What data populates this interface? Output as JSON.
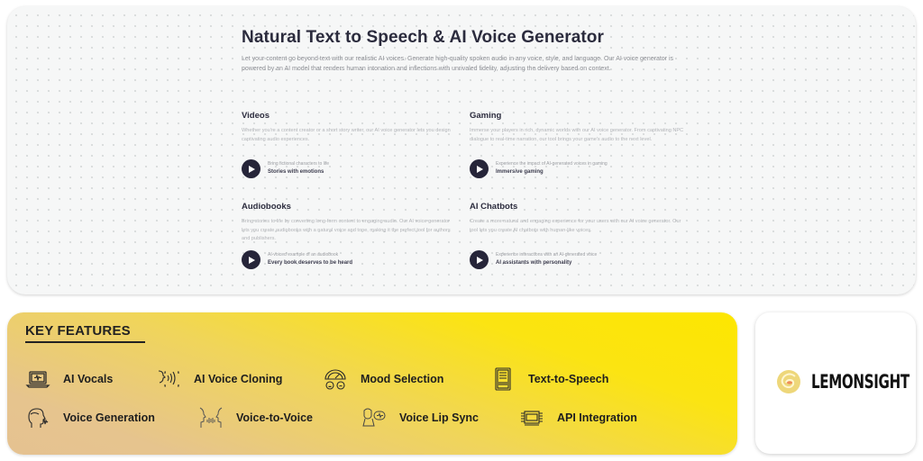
{
  "hero": {
    "title": "Natural Text to Speech & AI Voice Generator",
    "description": "Let your content go beyond text with our realistic AI voices. Generate high-quality spoken audio in any voice, style, and language. Our AI voice generator is powered by an AI model that renders human intonation and inflections with unrivaled fidelity, adjusting the delivery based on context."
  },
  "use_cases": [
    {
      "title": "Videos",
      "description": "Whether you're a content creator or a short story writer, our AI voice generator lets you design captivating audio experiences.",
      "sample_caption": "Bring fictional characters to life",
      "sample_title": "Stories with emotions"
    },
    {
      "title": "Gaming",
      "description": "Immerse your players in rich, dynamic worlds with our AI voice generator. From captivating NPC dialogue to real-time narration, our tool brings your game's audio to the next level.",
      "sample_caption": "Experience the impact of AI-generated voices in gaming",
      "sample_title": "Immersive gaming"
    },
    {
      "title": "Audiobooks",
      "description": "Bring stories to life by converting long-form content to engaging audio. Our AI voice generator lets you create audiobooks with a natural voice and tone, making it the perfect tool for authors and publishers.",
      "sample_caption": "AI-voiced example of an audiobook",
      "sample_title": "Every book deserves to be heard"
    },
    {
      "title": "AI Chatbots",
      "description": "Create a more natural and engaging experience for your users with our AI voice generator. Our tool lets you create AI chatbots with human-like voices.",
      "sample_caption": "Experience interactions with an AI-generated voice",
      "sample_title": "AI assistants with personality"
    }
  ],
  "features": {
    "title": "KEY FEATURES",
    "items": [
      {
        "label": "AI Vocals",
        "icon": "laptop-waveform-icon"
      },
      {
        "label": "AI Voice Cloning",
        "icon": "voice-cloning-icon"
      },
      {
        "label": "Mood Selection",
        "icon": "mood-gauge-icon"
      },
      {
        "label": "Text-to-Speech",
        "icon": "text-document-icon"
      },
      {
        "label": "Voice Generation",
        "icon": "head-voice-icon"
      },
      {
        "label": "Voice-to-Voice",
        "icon": "face-to-face-icon"
      },
      {
        "label": "Voice Lip Sync",
        "icon": "lip-sync-icon"
      },
      {
        "label": "API Integration",
        "icon": "api-chip-icon"
      }
    ]
  },
  "brand": {
    "name": "LEMONSIGHT",
    "logo_color": "#eed77a",
    "logo_accent": "#f08a5a"
  },
  "colors": {
    "dark": "#262539",
    "feature_yellow": "#fde600",
    "feature_tan": "#e5c291"
  }
}
